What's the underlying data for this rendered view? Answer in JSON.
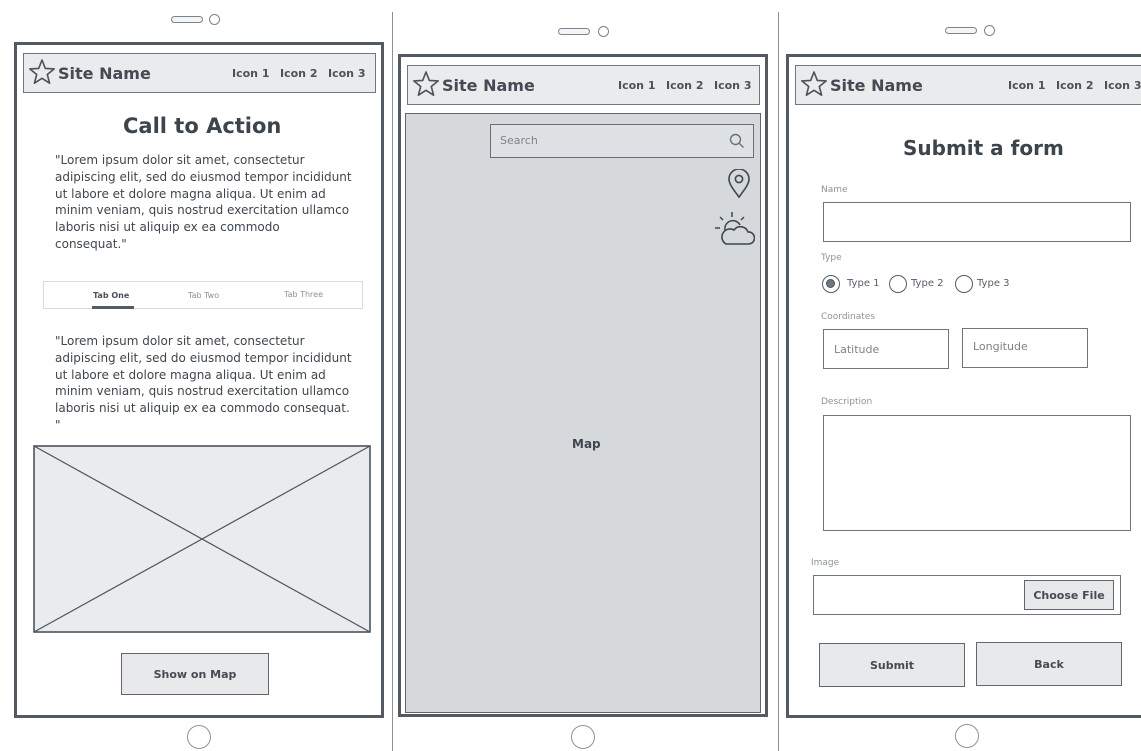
{
  "site": {
    "name": "Site Name",
    "icons": [
      "Icon 1",
      "Icon 2",
      "Icon 3"
    ]
  },
  "home": {
    "title": "Call to Action",
    "paragraph1": "\"Lorem ipsum dolor sit amet, consectetur adipiscing elit, sed do eiusmod tempor incididunt ut labore et dolore magna aliqua. Ut enim ad minim veniam, quis nostrud exercitation ullamco laboris nisi ut aliquip ex ea commodo consequat.\"",
    "tabs": [
      "Tab One",
      "Tab Two",
      "Tab Three"
    ],
    "active_tab": "Tab One",
    "paragraph2": "\"Lorem ipsum dolor sit amet, consectetur adipiscing elit, sed do eiusmod tempor incididunt ut labore et dolore magna aliqua. Ut enim ad minim veniam, quis nostrud exercitation ullamco laboris nisi ut aliquip ex ea commodo consequat. \"",
    "show_map_button": "Show on Map"
  },
  "map": {
    "search_placeholder": "Search",
    "map_label": "Map",
    "icons": [
      "location-pin-icon",
      "weather-icon"
    ]
  },
  "form": {
    "title": "Submit a form",
    "name_label": "Name",
    "type_label": "Type",
    "types": [
      "Type 1",
      "Type 2",
      "Type 3"
    ],
    "selected_type": "Type 1",
    "coordinates_label": "Coordinates",
    "latitude_placeholder": "Latitude",
    "longitude_placeholder": "Longitude",
    "description_label": "Description",
    "image_label": "Image",
    "choose_file_button": "Choose File",
    "submit_button": "Submit",
    "back_button": "Back"
  }
}
